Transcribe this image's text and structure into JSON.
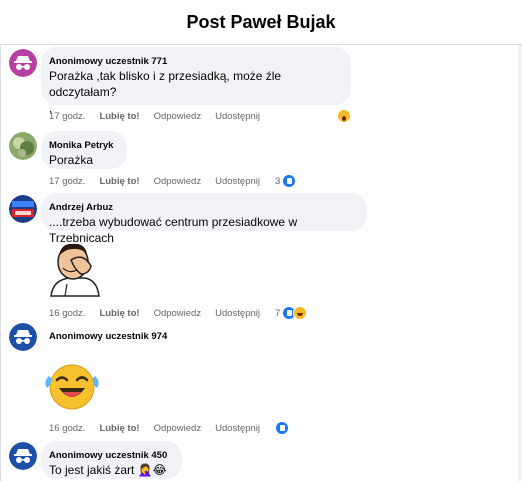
{
  "header": {
    "title": "Post Paweł Bujak"
  },
  "actions_labels": {
    "like": "Lubię to!",
    "reply": "Odpowiedz",
    "share": "Udostępnij"
  },
  "comments": [
    {
      "author": "Anonimowy uczestnik 771",
      "text_line1": "Porażka ,tak blisko i z przesiadką, może źle odczytałam?",
      "text_line2": ",",
      "time": "17 godz.",
      "reactions": {
        "icons": [
          "wow-reaction-icon"
        ],
        "count": ""
      }
    },
    {
      "author": "Monika Petryk",
      "text_line1": "Porażka",
      "time": "17 godz.",
      "reactions": {
        "icons": [
          "like-reaction-icon"
        ],
        "count": "3"
      }
    },
    {
      "author": "Andrzej Arbuz",
      "text_line1": "....trzeba wybudować centrum przesiadkowe w Trzebnicach",
      "time": "16 godz.",
      "reactions": {
        "icons": [
          "like-reaction-icon",
          "haha-reaction-icon"
        ],
        "count": "7"
      }
    },
    {
      "author": "Anonimowy uczestnik 974",
      "time": "16 godz.",
      "reactions": {
        "icons": [
          "like-reaction-icon"
        ],
        "count": ""
      }
    },
    {
      "author": "Anonimowy uczestnik 450",
      "text_line1": "To jest jakiś żart 🤦‍♀️😂"
    }
  ],
  "colors": {
    "accent": "#1877f2",
    "bubble": "#f0f2f5",
    "secondary_text": "#65676b"
  }
}
